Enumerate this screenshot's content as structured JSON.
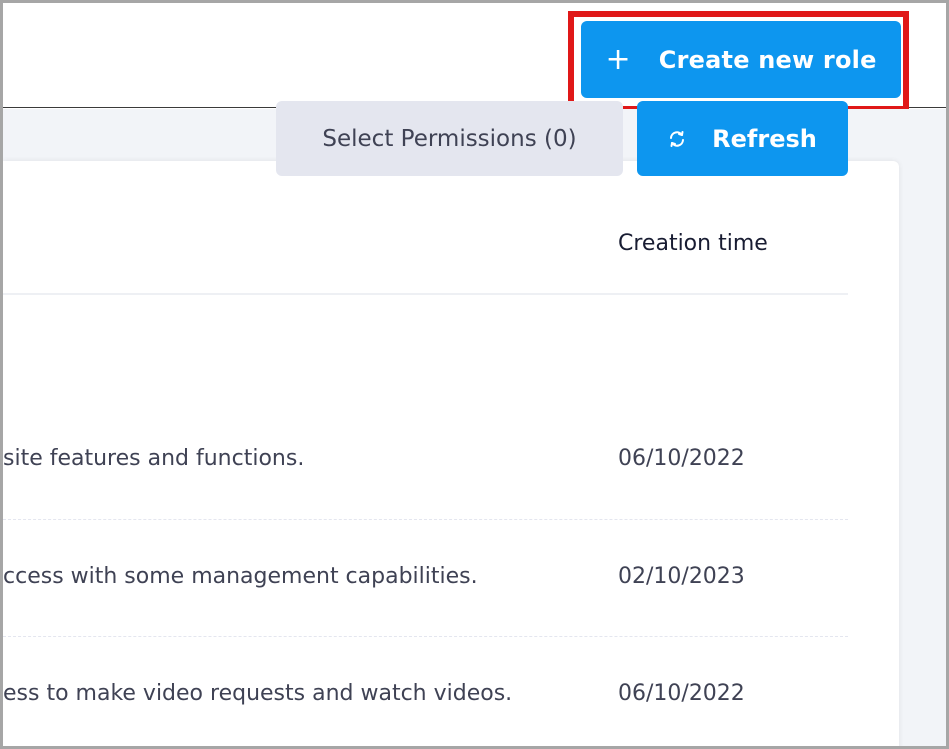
{
  "header": {
    "create_button": {
      "icon": "plus-icon",
      "label": "Create new role"
    }
  },
  "toolbar": {
    "select_permissions_label": "Select Permissions (0)",
    "refresh": {
      "icon": "refresh-icon",
      "label": "Refresh"
    }
  },
  "table": {
    "columns": [
      "Creation time"
    ],
    "rows": [
      {
        "description": "site features and functions.",
        "creation_time": "06/10/2022"
      },
      {
        "description": "ccess with some management capabilities.",
        "creation_time": "02/10/2023"
      },
      {
        "description": "ess to make video requests and watch videos.",
        "creation_time": "06/10/2022"
      }
    ]
  },
  "colors": {
    "primary": "#0d96ef",
    "highlight_border": "#e01818",
    "secondary_button": "#e4e6ef",
    "page_bg": "#f2f4f8"
  }
}
